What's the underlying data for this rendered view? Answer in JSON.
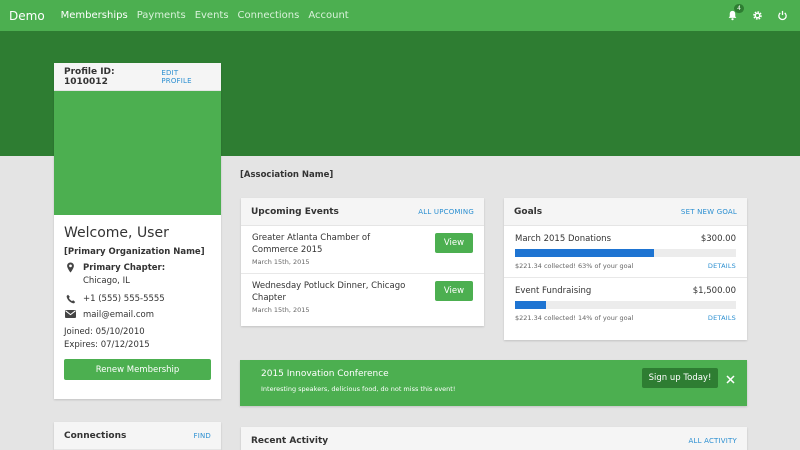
{
  "nav": {
    "brand": "Demo",
    "links": [
      "Memberships",
      "Payments",
      "Events",
      "Connections",
      "Account"
    ],
    "notification_count": "4"
  },
  "profile": {
    "id_label": "Profile ID: 1010012",
    "edit_label": "EDIT PROFILE",
    "welcome": "Welcome, User",
    "organization": "[Primary Organization Name]",
    "chapter_label": "Primary Chapter:",
    "chapter_city": "Chicago, IL",
    "phone": "+1 (555) 555-5555",
    "email": "mail@email.com",
    "joined": "Joined: 05/10/2010",
    "expires": "Expires: 07/12/2015",
    "renew_label": "Renew Membership"
  },
  "association_name": "[Association Name]",
  "upcoming_events": {
    "title": "Upcoming Events",
    "link": "ALL UPCOMING",
    "items": [
      {
        "name": "Greater Atlanta Chamber of Commerce 2015",
        "date": "March 15th, 2015",
        "button": "View"
      },
      {
        "name": "Wednesday Potluck Dinner, Chicago Chapter",
        "date": "March 15th, 2015",
        "button": "View"
      }
    ]
  },
  "goals": {
    "title": "Goals",
    "link": "SET NEW GOAL",
    "items": [
      {
        "name": "March 2015 Donations",
        "amount": "$300.00",
        "progress": 0.63,
        "status": "$221.34 collected! 63% of your goal",
        "details": "DETAILS"
      },
      {
        "name": "Event Fundraising",
        "amount": "$1,500.00",
        "progress": 0.14,
        "status": "$221.34 collected! 14% of your goal",
        "details": "DETAILS"
      }
    ]
  },
  "promo": {
    "title": "2015 Innovation Conference",
    "text": "Interesting speakers, delicious food, do not miss this event!",
    "button": "Sign up Today!",
    "close": "×"
  },
  "connections": {
    "title": "Connections",
    "link": "FIND"
  },
  "recent_activity": {
    "title": "Recent Activity",
    "link": "ALL ACTIVITY"
  },
  "colors": {
    "primary": "#4caf50",
    "dark": "#2e7d32",
    "progress": "#1e74d2",
    "link": "#2b8fd1"
  },
  "icons": [
    "bell-icon",
    "gear-icon",
    "power-icon",
    "map-marker-icon",
    "phone-icon",
    "envelope-icon",
    "close-icon"
  ]
}
